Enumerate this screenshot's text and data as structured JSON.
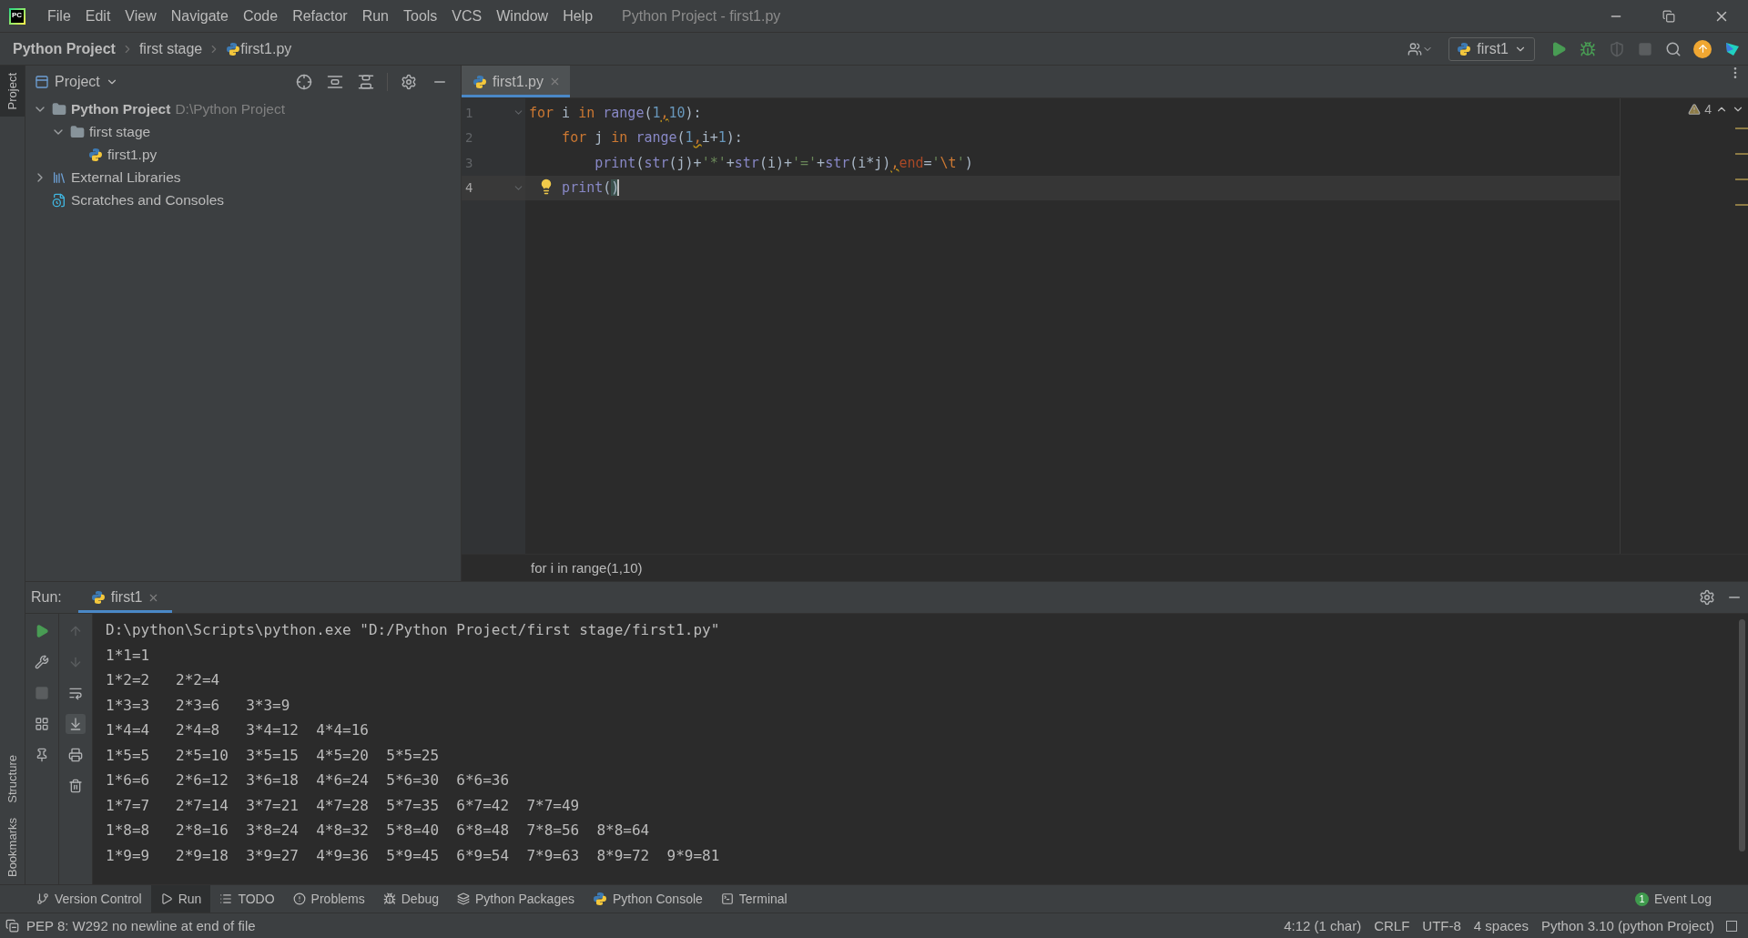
{
  "window": {
    "logo": "PC",
    "title": "Python Project - first1.py",
    "menu": [
      "File",
      "Edit",
      "View",
      "Navigate",
      "Code",
      "Refactor",
      "Run",
      "Tools",
      "VCS",
      "Window",
      "Help"
    ]
  },
  "breadcrumbs": [
    {
      "label": "Python Project",
      "kind": "project"
    },
    {
      "label": "first stage",
      "kind": "folder"
    },
    {
      "label": "first1.py",
      "kind": "file"
    }
  ],
  "toolbar": {
    "run_config": "first1"
  },
  "left_stripe_top": [
    {
      "label": "Project",
      "selected": true
    }
  ],
  "left_stripe_bottom": [
    {
      "label": "Structure",
      "selected": false
    },
    {
      "label": "Bookmarks",
      "selected": false
    }
  ],
  "project_panel": {
    "title": "Project",
    "tree": [
      {
        "label": "Python Project",
        "hint": "D:\\Python Project",
        "kind": "project",
        "expanded": true,
        "children": [
          {
            "label": "first stage",
            "kind": "folder",
            "expanded": true,
            "children": [
              {
                "label": "first1.py",
                "kind": "file"
              }
            ]
          }
        ]
      },
      {
        "label": "External Libraries",
        "kind": "library",
        "expanded": false
      },
      {
        "label": "Scratches and Consoles",
        "kind": "scratches"
      }
    ]
  },
  "editor": {
    "tabs": [
      {
        "label": "first1.py",
        "selected": true
      }
    ],
    "warnings": "4",
    "lines": [
      {
        "number": "1",
        "fold": true,
        "bulb": false,
        "current": false,
        "tokens": [
          {
            "text": "for",
            "kind": "keyword"
          },
          {
            "text": " i ",
            "kind": "plain"
          },
          {
            "text": "in",
            "kind": "keyword"
          },
          {
            "text": " range",
            "kind": "builtin"
          },
          {
            "text": "(",
            "kind": "plain"
          },
          {
            "text": "1",
            "kind": "number"
          },
          {
            "text": ",",
            "kind": "warn"
          },
          {
            "text": "10",
            "kind": "number"
          },
          {
            "text": "):",
            "kind": "plain"
          }
        ]
      },
      {
        "number": "2",
        "fold": false,
        "bulb": false,
        "current": false,
        "tokens": [
          {
            "text": "    for",
            "kind": "keyword"
          },
          {
            "text": " j ",
            "kind": "plain"
          },
          {
            "text": "in",
            "kind": "keyword"
          },
          {
            "text": " range",
            "kind": "builtin"
          },
          {
            "text": "(",
            "kind": "plain"
          },
          {
            "text": "1",
            "kind": "number"
          },
          {
            "text": ",",
            "kind": "warn"
          },
          {
            "text": "i+",
            "kind": "plain"
          },
          {
            "text": "1",
            "kind": "number"
          },
          {
            "text": "):",
            "kind": "plain"
          }
        ]
      },
      {
        "number": "3",
        "fold": false,
        "bulb": false,
        "current": false,
        "tokens": [
          {
            "text": "        print",
            "kind": "builtin"
          },
          {
            "text": "(",
            "kind": "plain"
          },
          {
            "text": "str",
            "kind": "builtin"
          },
          {
            "text": "(j)+",
            "kind": "plain"
          },
          {
            "text": "'*'",
            "kind": "string"
          },
          {
            "text": "+",
            "kind": "plain"
          },
          {
            "text": "str",
            "kind": "builtin"
          },
          {
            "text": "(i)+",
            "kind": "plain"
          },
          {
            "text": "'='",
            "kind": "string"
          },
          {
            "text": "+",
            "kind": "plain"
          },
          {
            "text": "str",
            "kind": "builtin"
          },
          {
            "text": "(i*j)",
            "kind": "plain"
          },
          {
            "text": ",",
            "kind": "warn"
          },
          {
            "text": "end",
            "kind": "param"
          },
          {
            "text": "=",
            "kind": "plain"
          },
          {
            "text": "'",
            "kind": "string"
          },
          {
            "text": "\\t",
            "kind": "escape"
          },
          {
            "text": "'",
            "kind": "string"
          },
          {
            "text": ")",
            "kind": "plain"
          }
        ]
      },
      {
        "number": "4",
        "fold": true,
        "bulb": true,
        "current": true,
        "tokens": [
          {
            "text": "    print",
            "kind": "builtin"
          },
          {
            "text": "(",
            "kind": "plain"
          },
          {
            "text": ")",
            "kind": "match"
          }
        ]
      }
    ],
    "breadcrumb": "for i in range(1,10)"
  },
  "run": {
    "title": "Run:",
    "tabs": [
      {
        "label": "first1",
        "selected": true
      }
    ],
    "output": [
      "D:\\python\\Scripts\\python.exe \"D:/Python Project/first stage/first1.py\"",
      "1*1=1",
      "1*2=2\t2*2=4",
      "1*3=3\t2*3=6\t3*3=9",
      "1*4=4\t2*4=8\t3*4=12\t4*4=16",
      "1*5=5\t2*5=10\t3*5=15\t4*5=20\t5*5=25",
      "1*6=6\t2*6=12\t3*6=18\t4*6=24\t5*6=30\t6*6=36",
      "1*7=7\t2*7=14\t3*7=21\t4*7=28\t5*7=35\t6*7=42\t7*7=49",
      "1*8=8\t2*8=16\t3*8=24\t4*8=32\t5*8=40\t6*8=48\t7*8=56\t8*8=64",
      "1*9=9\t2*9=18\t3*9=27\t4*9=36\t5*9=45\t6*9=54\t7*9=63\t8*9=72\t9*9=81"
    ]
  },
  "tool_windows": [
    {
      "label": "Version Control",
      "kind": "vcs",
      "selected": false
    },
    {
      "label": "Run",
      "kind": "run",
      "selected": true
    },
    {
      "label": "TODO",
      "kind": "todo",
      "selected": false
    },
    {
      "label": "Problems",
      "kind": "problems",
      "selected": false
    },
    {
      "label": "Debug",
      "kind": "debug",
      "selected": false
    },
    {
      "label": "Python Packages",
      "kind": "packages",
      "selected": false
    },
    {
      "label": "Python Console",
      "kind": "console",
      "selected": false
    },
    {
      "label": "Terminal",
      "kind": "terminal",
      "selected": false
    }
  ],
  "event_log": {
    "label": "Event Log",
    "count": "1"
  },
  "status_bar": {
    "message": "PEP 8: W292 no newline at end of file",
    "items": [
      "4:12 (1 char)",
      "CRLF",
      "UTF-8",
      "4 spaces",
      "Python 3.10 (python Project)"
    ]
  }
}
